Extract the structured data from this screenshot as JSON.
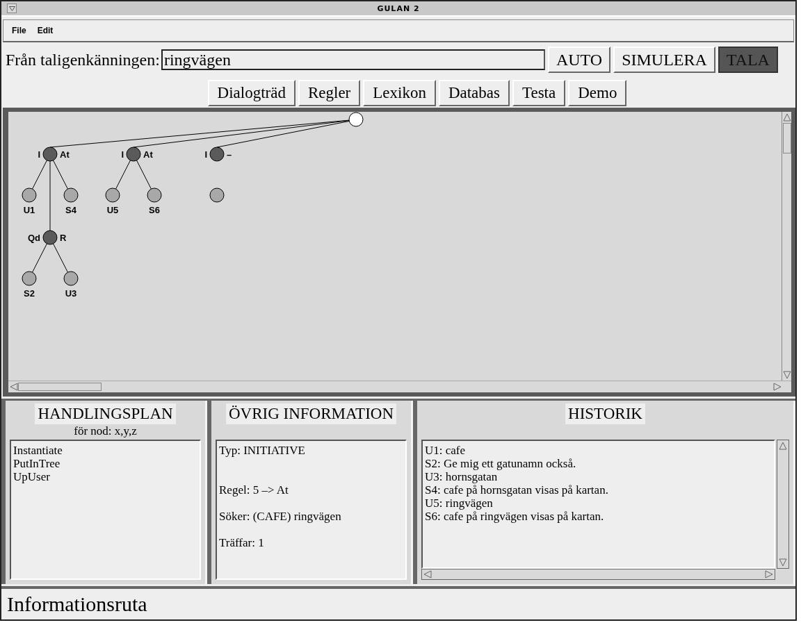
{
  "window": {
    "title": "GULAN 2"
  },
  "menu": [
    "File",
    "Edit"
  ],
  "recognition": {
    "label": "Från taligenkänningen:",
    "value": "ringvägen"
  },
  "buttons": [
    {
      "label": "AUTO",
      "active": false
    },
    {
      "label": "SIMULERA",
      "active": false
    },
    {
      "label": "TALA",
      "active": true
    }
  ],
  "tabs": [
    "Dialogträd",
    "Regler",
    "Lexikon",
    "Databas",
    "Testa",
    "Demo"
  ],
  "tree": {
    "kind": "root",
    "children": [
      {
        "kind": "move",
        "left": "I",
        "right": "At",
        "children": [
          {
            "kind": "turn",
            "label": "U1"
          },
          {
            "kind": "turn",
            "label": "S4"
          },
          {
            "kind": "move",
            "left": "Qd",
            "right": "R",
            "children": [
              {
                "kind": "turn",
                "label": "S2"
              },
              {
                "kind": "turn",
                "label": "U3"
              }
            ]
          }
        ]
      },
      {
        "kind": "move",
        "left": "I",
        "right": "At",
        "children": [
          {
            "kind": "turn",
            "label": "U5"
          },
          {
            "kind": "turn",
            "label": "S6"
          }
        ]
      },
      {
        "kind": "move",
        "left": "I",
        "right": "–",
        "children": [
          {
            "kind": "turn",
            "linked": false
          }
        ]
      }
    ]
  },
  "plan": {
    "title": "HANDLINGSPLAN",
    "subtitle": "för nod: x,y,z",
    "items": [
      "Instantiate",
      "PutInTree",
      "UpUser"
    ]
  },
  "info": {
    "title": "ÖVRIG INFORMATION",
    "sections": [
      [
        "Typ: INITIATIVE"
      ],
      [
        "Regel: 5 –> At",
        "Söker: (CAFE) ringvägen",
        "Träffar: 1"
      ]
    ]
  },
  "history": {
    "title": "HISTORIK",
    "lines": [
      "U1: cafe",
      "S2: Ge mig ett gatunamn också.",
      "U3: hornsgatan",
      "S4: cafe på hornsgatan visas på kartan.",
      "U5: ringvägen",
      "S6: cafe på ringvägen visas på kartan."
    ]
  },
  "status": "Informationsruta"
}
